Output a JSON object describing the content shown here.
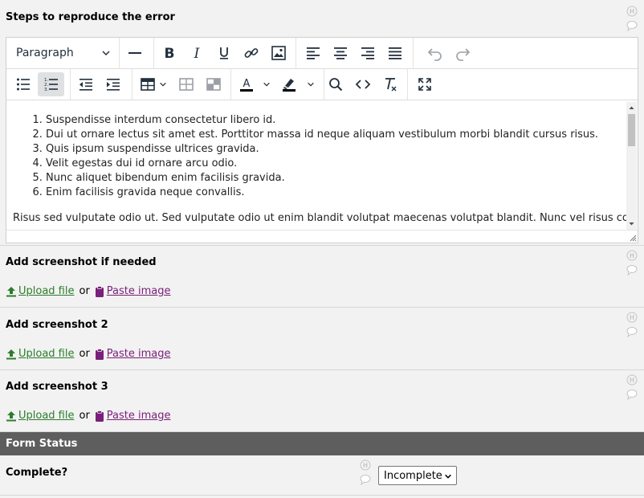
{
  "steps_field": {
    "label": "Steps to reproduce the error",
    "format_select": "Paragraph",
    "list_items": [
      "Suspendisse interdum consectetur libero id.",
      "Dui ut ornare lectus sit amet est. Porttitor massa id neque aliquam vestibulum morbi blandit cursus risus.",
      "Quis ipsum suspendisse ultrices gravida.",
      "Velit egestas dui id ornare arcu odio.",
      "Nunc aliquet bibendum enim facilisis gravida.",
      "Enim facilisis gravida neque convallis."
    ],
    "paragraph": "Risus sed vulputate odio ut. Sed vulputate odio ut enim blandit volutpat maecenas volutpat blandit. Nunc vel risus commodo"
  },
  "screenshots": [
    {
      "label": "Add screenshot if needed",
      "upload_label": "Upload file",
      "or": "or",
      "paste_label": "Paste image"
    },
    {
      "label": "Add screenshot 2",
      "upload_label": "Upload file",
      "or": "or",
      "paste_label": "Paste image"
    },
    {
      "label": "Add screenshot 3",
      "upload_label": "Upload file",
      "or": "or",
      "paste_label": "Paste image"
    }
  ],
  "form_status": {
    "header": "Form Status",
    "complete_label": "Complete?",
    "complete_value": "Incomplete"
  },
  "colors": {
    "link_green": "#2b7d2b",
    "link_purple": "#7a1f7a",
    "section_header": "#5e5e5e",
    "toolbar_icon": "#222f3e",
    "active_button": "#dee0e2"
  },
  "icons": {
    "history": "history-icon",
    "comment": "comment-icon",
    "upload": "upload-icon",
    "clipboard": "clipboard-icon"
  }
}
